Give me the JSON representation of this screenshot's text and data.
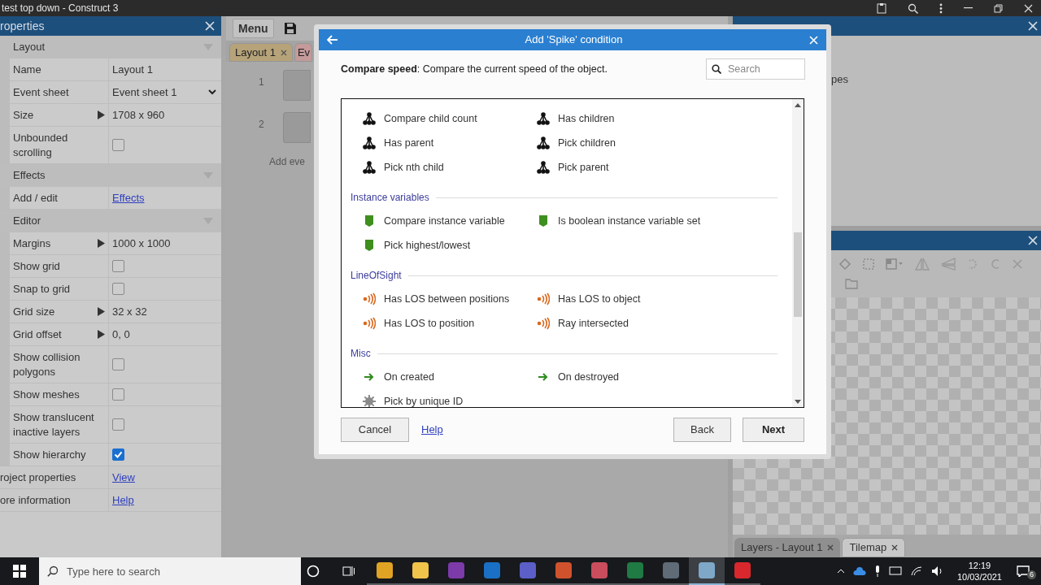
{
  "window": {
    "title": "test top down - Construct 3"
  },
  "properties": {
    "title": "roperties",
    "rows": [
      {
        "kind": "section",
        "label": "Layout"
      },
      {
        "kind": "text",
        "label": "Name",
        "value": "Layout 1"
      },
      {
        "kind": "dropdown",
        "label": "Event sheet",
        "value": "Event sheet 1"
      },
      {
        "kind": "expander",
        "label": "Size",
        "value": "1708 x 960"
      },
      {
        "kind": "checkbox",
        "label": "Unbounded scrolling",
        "checked": false
      },
      {
        "kind": "section",
        "label": "Effects"
      },
      {
        "kind": "link",
        "label": "Add / edit",
        "value": "Effects"
      },
      {
        "kind": "section",
        "label": "Editor"
      },
      {
        "kind": "expander",
        "label": "Margins",
        "value": "1000 x 1000"
      },
      {
        "kind": "checkbox",
        "label": "Show grid",
        "checked": false
      },
      {
        "kind": "checkbox",
        "label": "Snap to grid",
        "checked": false
      },
      {
        "kind": "expander",
        "label": "Grid size",
        "value": "32 x 32"
      },
      {
        "kind": "expander",
        "label": "Grid offset",
        "value": "0, 0"
      },
      {
        "kind": "checkbox",
        "label": "Show collision polygons",
        "checked": false
      },
      {
        "kind": "checkbox",
        "label": "Show meshes",
        "checked": false
      },
      {
        "kind": "checkbox",
        "label": "Show translucent inactive layers",
        "checked": false
      },
      {
        "kind": "checkbox",
        "label": "Show hierarchy",
        "checked": true
      }
    ],
    "footer_rows": [
      {
        "label": "roject properties",
        "value": "View"
      },
      {
        "label": "ore information",
        "value": "Help"
      }
    ]
  },
  "editor": {
    "menu": "Menu",
    "tabs": [
      {
        "label": "Layout 1",
        "selected": false
      },
      {
        "label": "Ev",
        "selected": true
      }
    ],
    "event_rows": [
      "1",
      "2"
    ],
    "add_event": "Add eve"
  },
  "dialog": {
    "title": "Add 'Spike' condition",
    "description": "**Compare speed**: Compare the current speed of the object.",
    "search": {
      "placeholder": "Search"
    },
    "groups": [
      {
        "items": [
          {
            "kind": "hierarchy",
            "label": "Compare child count"
          },
          {
            "kind": "hierarchy",
            "label": "Has children"
          },
          {
            "kind": "hierarchy",
            "label": "Has parent"
          },
          {
            "kind": "hierarchy",
            "label": "Pick children"
          },
          {
            "kind": "hierarchy",
            "label": "Pick nth child"
          },
          {
            "kind": "hierarchy",
            "label": "Pick parent"
          }
        ]
      },
      {
        "heading": "Instance variables",
        "items": [
          {
            "kind": "variable",
            "label": "Compare instance variable"
          },
          {
            "kind": "variable",
            "label": "Is boolean instance variable set"
          },
          {
            "kind": "variable",
            "label": "Pick highest/lowest"
          }
        ]
      },
      {
        "heading": "LineOfSight",
        "items": [
          {
            "kind": "sight",
            "label": "Has LOS between positions"
          },
          {
            "kind": "sight",
            "label": "Has LOS to object"
          },
          {
            "kind": "sight",
            "label": "Has LOS to position"
          },
          {
            "kind": "sight",
            "label": "Ray intersected"
          }
        ]
      },
      {
        "heading": "Misc",
        "items": [
          {
            "kind": "trigger",
            "label": "On created"
          },
          {
            "kind": "trigger",
            "label": "On destroyed"
          },
          {
            "kind": "system",
            "label": "Pick by unique ID"
          }
        ]
      }
    ],
    "cancel": "Cancel",
    "help": "Help",
    "back": "Back",
    "next": "Next"
  },
  "project_panel": {
    "text": "pes"
  },
  "tilemap": {
    "tabs": [
      {
        "label": "Layers - Layout 1",
        "selected": false
      },
      {
        "label": "Tilemap",
        "selected": true
      }
    ]
  },
  "taskbar": {
    "search_placeholder": "Type here to search",
    "apps": [
      {
        "kind": "browser",
        "active": false
      },
      {
        "kind": "folder",
        "active": false
      },
      {
        "kind": "notes",
        "active": false
      },
      {
        "kind": "mail",
        "active": false
      },
      {
        "kind": "chat",
        "active": false
      },
      {
        "kind": "slides",
        "active": false
      },
      {
        "kind": "cloud",
        "active": false
      },
      {
        "kind": "sheet",
        "active": false
      },
      {
        "kind": "calculator",
        "active": false
      },
      {
        "kind": "construct",
        "active": true
      },
      {
        "kind": "recorder",
        "active": false
      }
    ],
    "time": "12:19",
    "date": "10/03/2021",
    "notifications": "6"
  }
}
